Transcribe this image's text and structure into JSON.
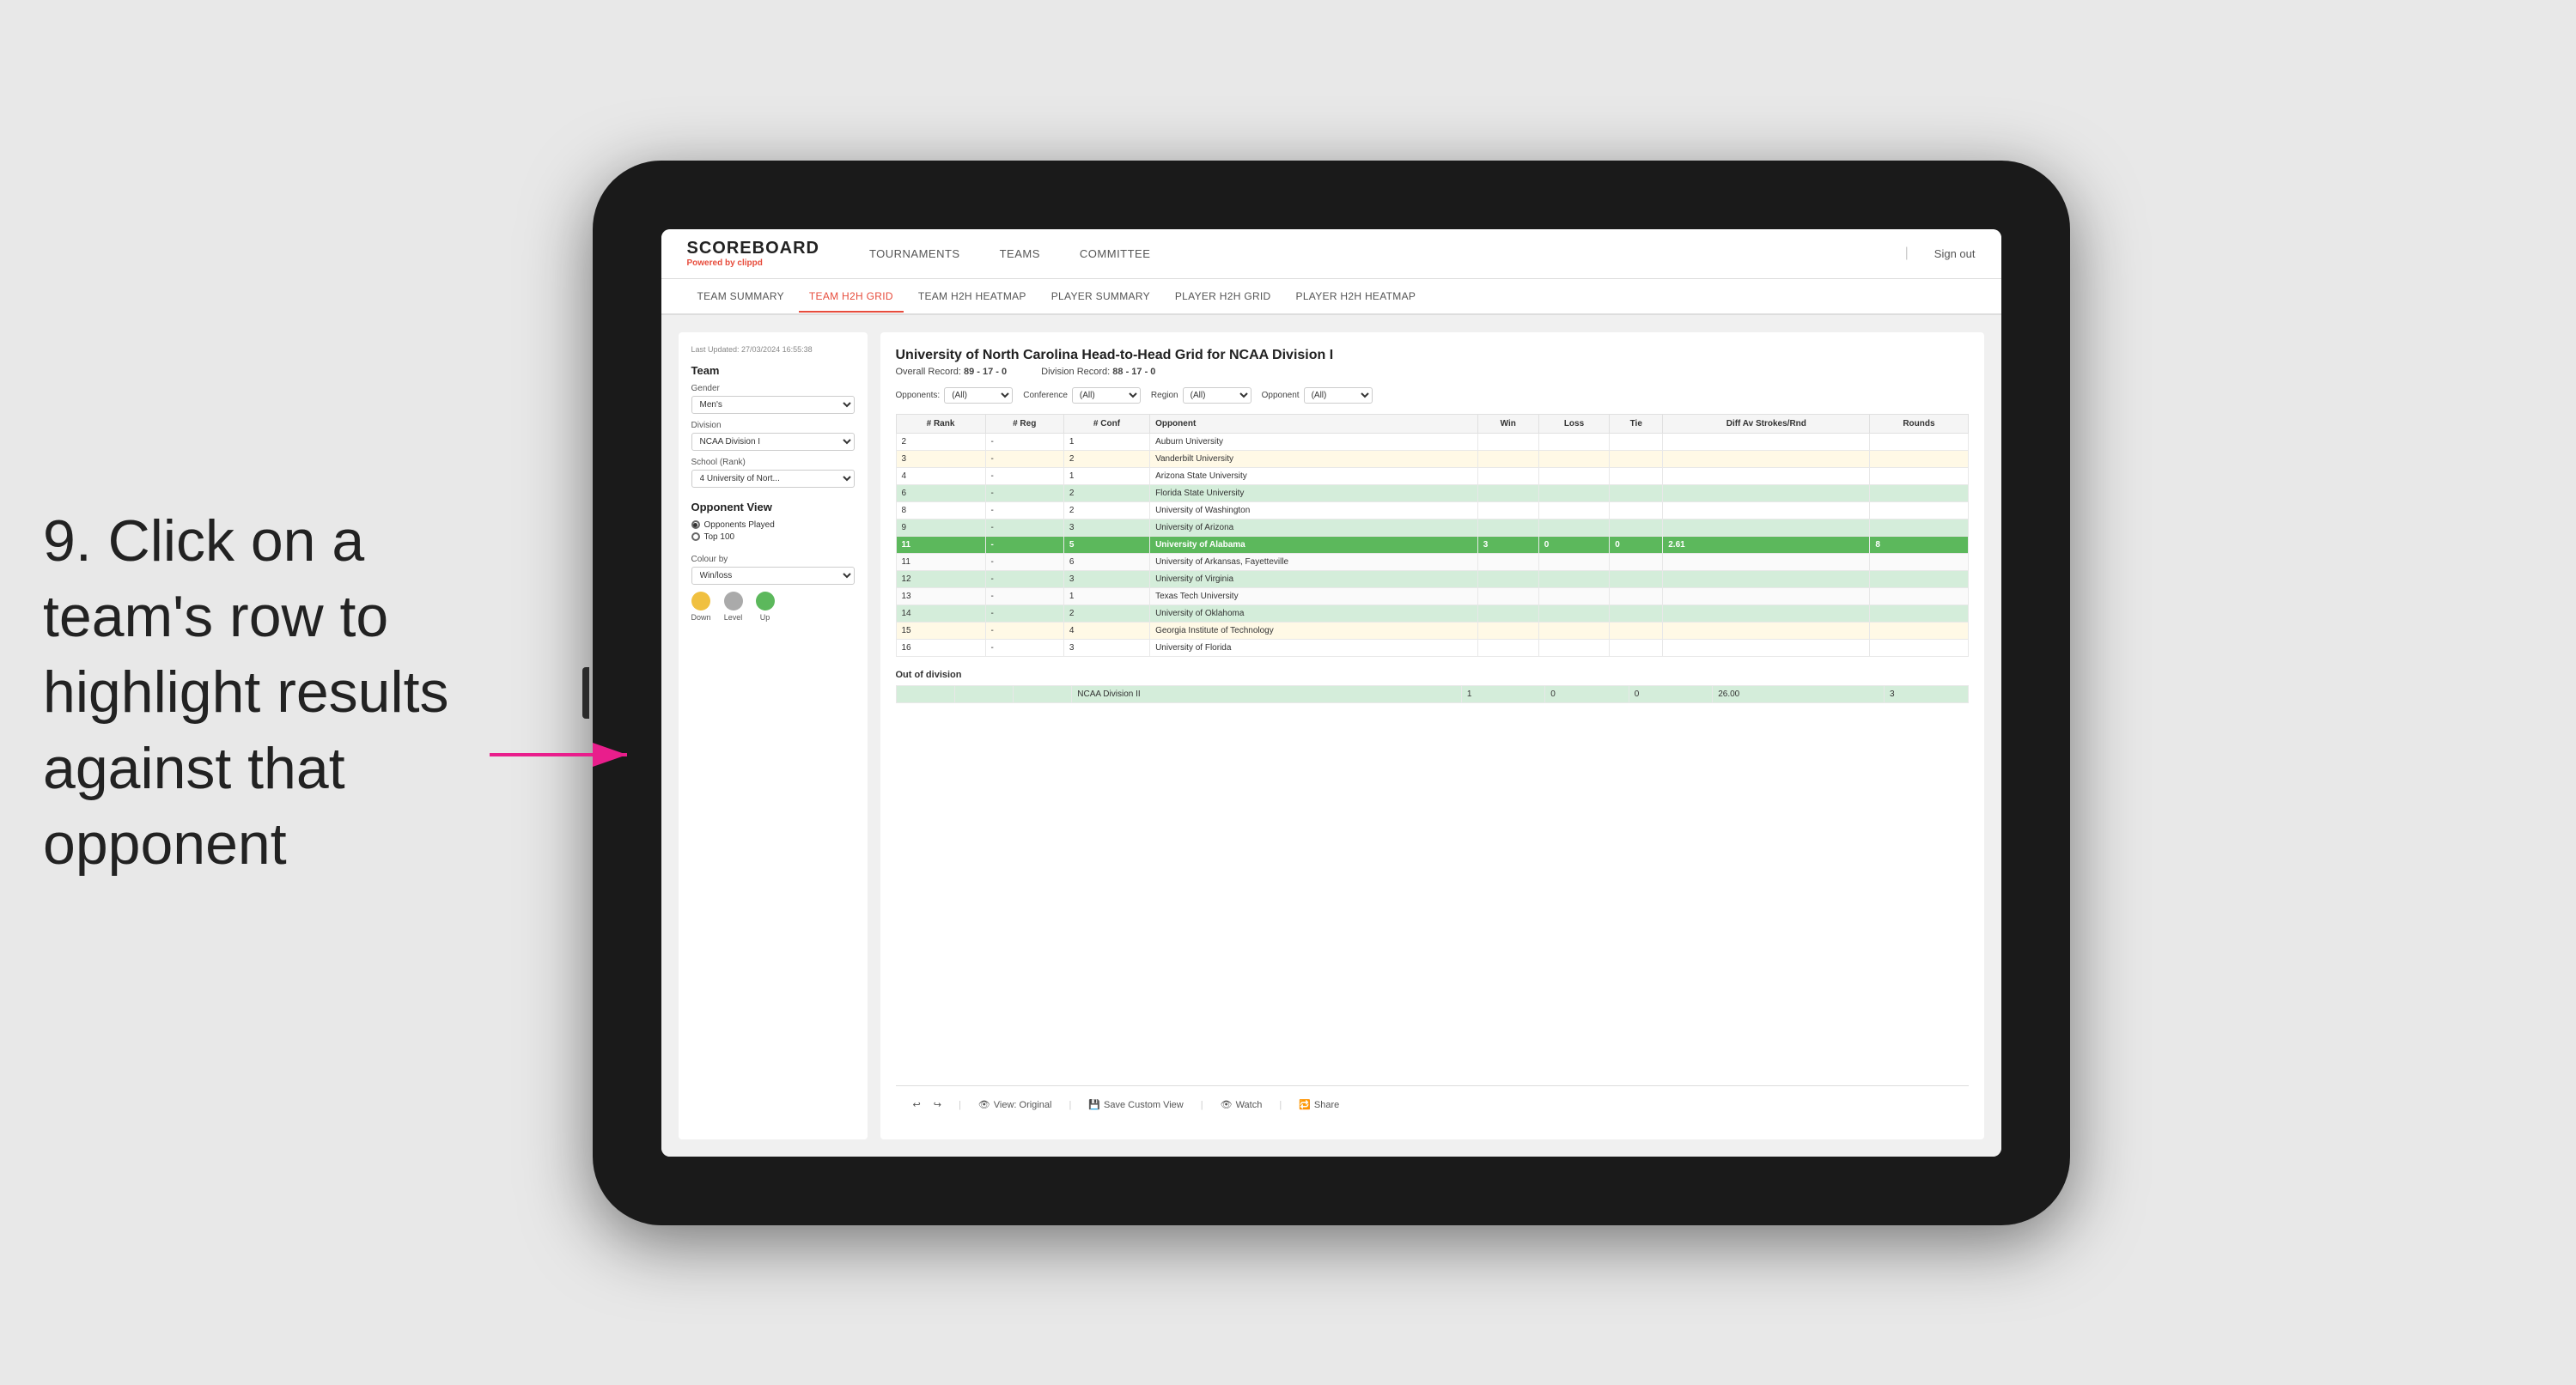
{
  "instruction": {
    "step": "9.",
    "text": "Click on a team's row to highlight results against that opponent"
  },
  "app": {
    "logo": "SCOREBOARD",
    "powered_by": "Powered by",
    "brand": "clippd",
    "sign_out": "Sign out"
  },
  "nav": {
    "items": [
      "TOURNAMENTS",
      "TEAMS",
      "COMMITTEE"
    ]
  },
  "sub_nav": {
    "items": [
      "TEAM SUMMARY",
      "TEAM H2H GRID",
      "TEAM H2H HEATMAP",
      "PLAYER SUMMARY",
      "PLAYER H2H GRID",
      "PLAYER H2H HEATMAP"
    ],
    "active": "TEAM H2H GRID"
  },
  "sidebar": {
    "last_updated": "Last Updated: 27/03/2024 16:55:38",
    "team_label": "Team",
    "gender_label": "Gender",
    "gender_value": "Men's",
    "division_label": "Division",
    "division_value": "NCAA Division I",
    "school_label": "School (Rank)",
    "school_value": "4 University of Nort...",
    "opponent_view_label": "Opponent View",
    "opponents_played": "Opponents Played",
    "top_100": "Top 100",
    "colour_by_label": "Colour by",
    "colour_by_value": "Win/loss",
    "legend": [
      {
        "label": "Down",
        "color": "#f0c040"
      },
      {
        "label": "Level",
        "color": "#aaaaaa"
      },
      {
        "label": "Up",
        "color": "#5cb85c"
      }
    ]
  },
  "main": {
    "title": "University of North Carolina Head-to-Head Grid for NCAA Division I",
    "overall_record_label": "Overall Record:",
    "overall_record_value": "89 - 17 - 0",
    "division_record_label": "Division Record:",
    "division_record_value": "88 - 17 - 0",
    "filters": {
      "opponents_label": "Opponents:",
      "opponents_value": "(All)",
      "conference_label": "Conference",
      "conference_value": "(All)",
      "region_label": "Region",
      "region_value": "(All)",
      "opponent_label": "Opponent",
      "opponent_value": "(All)"
    },
    "table_headers": [
      "# Rank",
      "# Reg",
      "# Conf",
      "Opponent",
      "Win",
      "Loss",
      "Tie",
      "Diff Av Strokes/Rnd",
      "Rounds"
    ],
    "rows": [
      {
        "rank": "2",
        "reg": "-",
        "conf": "1",
        "opponent": "Auburn University",
        "win": "",
        "loss": "",
        "tie": "",
        "diff": "",
        "rounds": "",
        "style": ""
      },
      {
        "rank": "3",
        "reg": "-",
        "conf": "2",
        "opponent": "Vanderbilt University",
        "win": "",
        "loss": "",
        "tie": "",
        "diff": "",
        "rounds": "",
        "style": "light-yellow"
      },
      {
        "rank": "4",
        "reg": "-",
        "conf": "1",
        "opponent": "Arizona State University",
        "win": "",
        "loss": "",
        "tie": "",
        "diff": "",
        "rounds": "",
        "style": ""
      },
      {
        "rank": "6",
        "reg": "-",
        "conf": "2",
        "opponent": "Florida State University",
        "win": "",
        "loss": "",
        "tie": "",
        "diff": "",
        "rounds": "",
        "style": "light-green"
      },
      {
        "rank": "8",
        "reg": "-",
        "conf": "2",
        "opponent": "University of Washington",
        "win": "",
        "loss": "",
        "tie": "",
        "diff": "",
        "rounds": "",
        "style": ""
      },
      {
        "rank": "9",
        "reg": "-",
        "conf": "3",
        "opponent": "University of Arizona",
        "win": "",
        "loss": "",
        "tie": "",
        "diff": "",
        "rounds": "",
        "style": "light-green"
      },
      {
        "rank": "11",
        "reg": "-",
        "conf": "5",
        "opponent": "University of Alabama",
        "win": "3",
        "loss": "0",
        "tie": "0",
        "diff": "2.61",
        "rounds": "8",
        "style": "highlighted"
      },
      {
        "rank": "11",
        "reg": "-",
        "conf": "6",
        "opponent": "University of Arkansas, Fayetteville",
        "win": "",
        "loss": "",
        "tie": "",
        "diff": "",
        "rounds": "",
        "style": ""
      },
      {
        "rank": "12",
        "reg": "-",
        "conf": "3",
        "opponent": "University of Virginia",
        "win": "",
        "loss": "",
        "tie": "",
        "diff": "",
        "rounds": "",
        "style": "light-green"
      },
      {
        "rank": "13",
        "reg": "-",
        "conf": "1",
        "opponent": "Texas Tech University",
        "win": "",
        "loss": "",
        "tie": "",
        "diff": "",
        "rounds": "",
        "style": ""
      },
      {
        "rank": "14",
        "reg": "-",
        "conf": "2",
        "opponent": "University of Oklahoma",
        "win": "",
        "loss": "",
        "tie": "",
        "diff": "",
        "rounds": "",
        "style": "light-green"
      },
      {
        "rank": "15",
        "reg": "-",
        "conf": "4",
        "opponent": "Georgia Institute of Technology",
        "win": "",
        "loss": "",
        "tie": "",
        "diff": "",
        "rounds": "",
        "style": "light-yellow"
      },
      {
        "rank": "16",
        "reg": "-",
        "conf": "3",
        "opponent": "University of Florida",
        "win": "",
        "loss": "",
        "tie": "",
        "diff": "",
        "rounds": "",
        "style": ""
      }
    ],
    "out_of_division_label": "Out of division",
    "out_of_division_row": {
      "label": "NCAA Division II",
      "win": "1",
      "loss": "0",
      "tie": "0",
      "diff": "26.00",
      "rounds": "3"
    }
  },
  "toolbar": {
    "view_label": "View: Original",
    "save_custom": "Save Custom View",
    "watch": "Watch",
    "share": "Share"
  },
  "colors": {
    "accent_red": "#e74c3c",
    "highlight_green": "#5cb85c",
    "light_green": "#d4edda",
    "light_yellow": "#fff9e6",
    "legend_down": "#f0c040",
    "legend_level": "#aaaaaa",
    "legend_up": "#5cb85c"
  }
}
